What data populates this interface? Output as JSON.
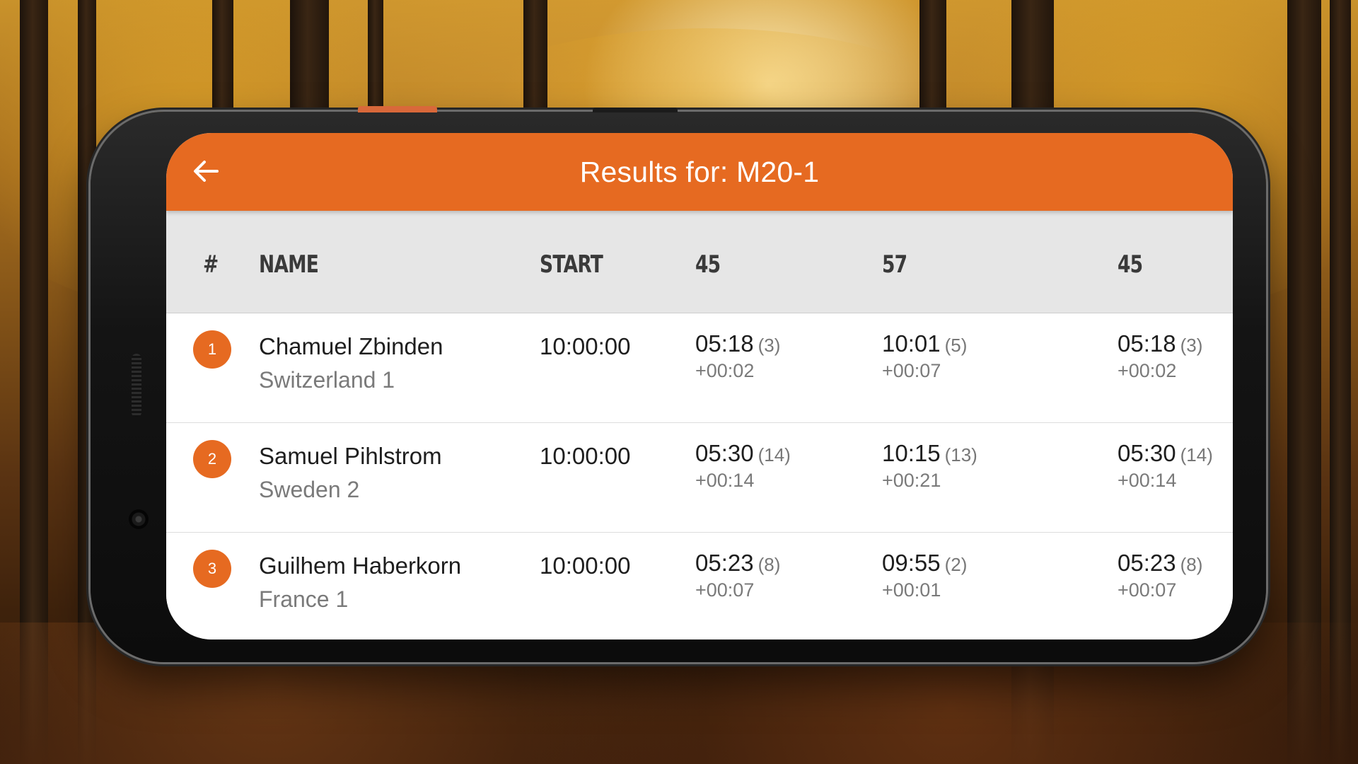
{
  "appbar": {
    "title": "Results for: M20-1"
  },
  "table": {
    "columns": [
      "#",
      "NAME",
      "START",
      "45",
      "57",
      "45"
    ],
    "rows": [
      {
        "rank": "1",
        "name": "Chamuel Zbinden",
        "team": "Switzerland 1",
        "start": "10:00:00",
        "splits": [
          {
            "time": "05:18",
            "pos": "(3)",
            "diff": "+00:02"
          },
          {
            "time": "10:01",
            "pos": "(5)",
            "diff": "+00:07"
          },
          {
            "time": "05:18",
            "pos": "(3)",
            "diff": "+00:02"
          }
        ]
      },
      {
        "rank": "2",
        "name": "Samuel Pihlstrom",
        "team": "Sweden 2",
        "start": "10:00:00",
        "splits": [
          {
            "time": "05:30",
            "pos": "(14)",
            "diff": "+00:14"
          },
          {
            "time": "10:15",
            "pos": "(13)",
            "diff": "+00:21"
          },
          {
            "time": "05:30",
            "pos": "(14)",
            "diff": "+00:14"
          }
        ]
      },
      {
        "rank": "3",
        "name": "Guilhem Haberkorn",
        "team": "France 1",
        "start": "10:00:00",
        "splits": [
          {
            "time": "05:23",
            "pos": "(8)",
            "diff": "+00:07"
          },
          {
            "time": "09:55",
            "pos": "(2)",
            "diff": "+00:01"
          },
          {
            "time": "05:23",
            "pos": "(8)",
            "diff": "+00:07"
          }
        ]
      }
    ]
  },
  "colors": {
    "accent": "#e66a21",
    "header_bg": "#e6e6e6"
  },
  "icons": {
    "back": "arrow-left-icon"
  }
}
